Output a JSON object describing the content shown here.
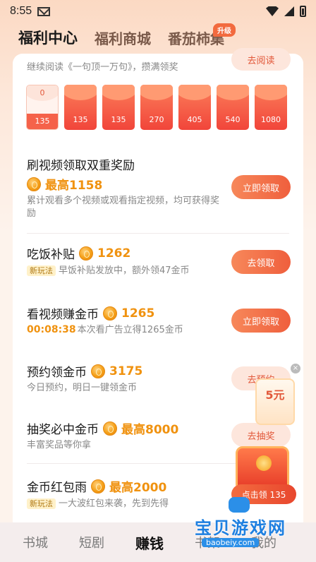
{
  "status": {
    "time": "8:55"
  },
  "tabs": [
    {
      "label": "福利中心",
      "active": true
    },
    {
      "label": "福利商城",
      "active": false
    },
    {
      "label": "番茄柿集",
      "active": false,
      "badge": "升级"
    }
  ],
  "read_task": {
    "desc": "继续阅读《一句顶一万句》，攒满领奖",
    "button": "去阅读"
  },
  "envelopes": [
    {
      "top": "0",
      "amount": "135",
      "opened": true
    },
    {
      "amount": "135"
    },
    {
      "amount": "135"
    },
    {
      "amount": "270"
    },
    {
      "amount": "405"
    },
    {
      "amount": "540"
    },
    {
      "amount": "1080"
    }
  ],
  "tasks": [
    {
      "title": "刷视频领取双重奖励",
      "reward": "最高1158",
      "desc": "累计观看多个视频或观看指定视频，均可获得奖励",
      "button": "立即领取"
    },
    {
      "title": "吃饭补贴",
      "reward": "1262",
      "tag": "新玩法",
      "desc": "早饭补贴发放中，额外领47金币",
      "button": "去领取"
    },
    {
      "title": "看视频赚金币",
      "reward": "1265",
      "timer": "00:08:38",
      "desc": "本次看广告立得1265金币",
      "button": "立即领取"
    },
    {
      "title": "预约领金币",
      "reward": "3175",
      "desc": "今日预约，明日一键领金币",
      "button": "去预约"
    },
    {
      "title": "抽奖必中金币",
      "reward": "最高8000",
      "desc": "丰富奖品等你拿",
      "button": "去抽奖"
    },
    {
      "title": "金币红包雨",
      "reward": "最高2000",
      "tag": "新玩法",
      "desc": "一大波红包来袭，先到先得",
      "button": "点击领 135"
    }
  ],
  "float_widget": {
    "close": "×",
    "amount": "5元"
  },
  "bottom_nav": [
    {
      "label": "书城",
      "active": false
    },
    {
      "label": "短剧",
      "active": false
    },
    {
      "label": "赚钱",
      "active": true
    },
    {
      "label": "书架",
      "active": false
    },
    {
      "label": "我的",
      "active": false
    }
  ],
  "watermark": {
    "title": "宝贝游戏网",
    "url": "baobeiy.com"
  },
  "colors": {
    "accent": "#ef5f3d",
    "reward": "#f0920f",
    "bg": "#fdf3ec"
  }
}
